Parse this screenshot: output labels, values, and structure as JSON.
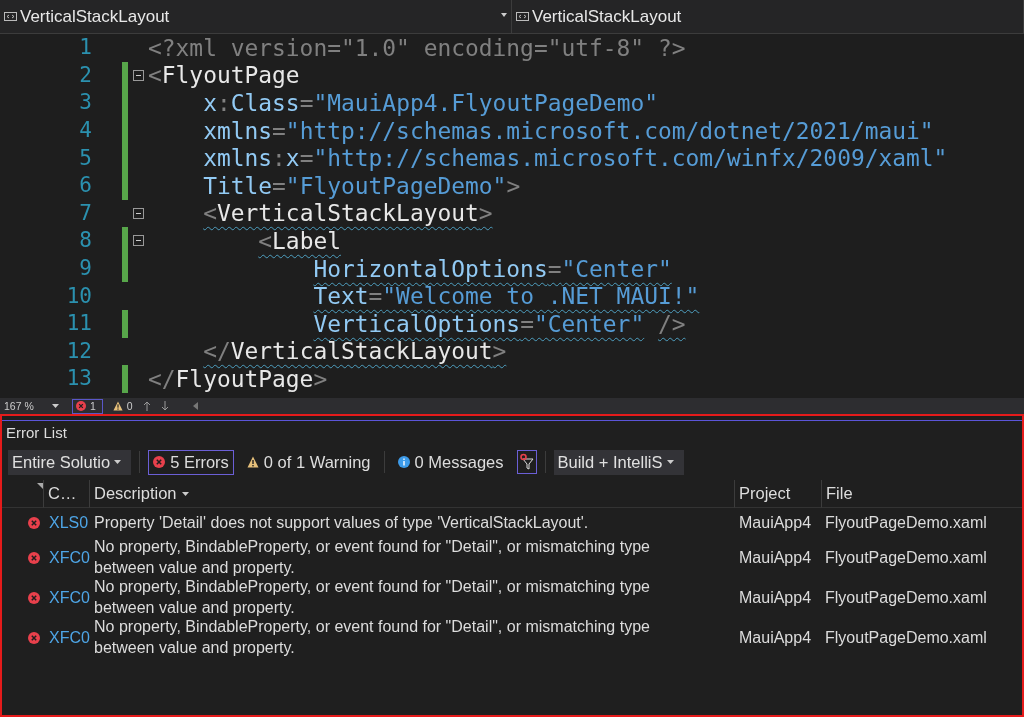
{
  "top_bar": {
    "dropdowns": [
      {
        "label": "VerticalStackLayout"
      },
      {
        "label": "VerticalStackLayout"
      }
    ]
  },
  "editor": {
    "lines": [
      {
        "number": "1",
        "modified": false,
        "fold": false,
        "squiggle": false,
        "tokens": [
          {
            "kind": "decl",
            "text": "<?xml version=\"1.0\" encoding=\"utf-8\" ?>"
          }
        ]
      },
      {
        "number": "2",
        "modified": true,
        "fold": true,
        "squiggle": false,
        "tokens": [
          {
            "kind": "punct",
            "text": "<"
          },
          {
            "kind": "tag",
            "text": "FlyoutPage"
          }
        ]
      },
      {
        "number": "3",
        "modified": true,
        "fold": false,
        "squiggle": false,
        "tokens": [
          {
            "kind": "attr",
            "text": "    x"
          },
          {
            "kind": "punct",
            "text": ":"
          },
          {
            "kind": "attr",
            "text": "Class"
          },
          {
            "kind": "punct",
            "text": "="
          },
          {
            "kind": "value",
            "text": "\"MauiApp4.FlyoutPageDemo\""
          }
        ]
      },
      {
        "number": "4",
        "modified": true,
        "fold": false,
        "squiggle": false,
        "tokens": [
          {
            "kind": "attr",
            "text": "    xmlns"
          },
          {
            "kind": "punct",
            "text": "="
          },
          {
            "kind": "value",
            "text": "\"http://schemas.microsoft.com/dotnet/2021/maui\""
          }
        ]
      },
      {
        "number": "5",
        "modified": true,
        "fold": false,
        "squiggle": false,
        "tokens": [
          {
            "kind": "attr",
            "text": "    xmlns"
          },
          {
            "kind": "punct",
            "text": ":"
          },
          {
            "kind": "attr",
            "text": "x"
          },
          {
            "kind": "punct",
            "text": "="
          },
          {
            "kind": "value",
            "text": "\"http://schemas.microsoft.com/winfx/2009/xaml\""
          }
        ]
      },
      {
        "number": "6",
        "modified": true,
        "fold": false,
        "squiggle": false,
        "tokens": [
          {
            "kind": "attr",
            "text": "    Title"
          },
          {
            "kind": "punct",
            "text": "="
          },
          {
            "kind": "value",
            "text": "\"FlyoutPageDemo\""
          },
          {
            "kind": "punct",
            "text": ">"
          }
        ]
      },
      {
        "number": "7",
        "modified": false,
        "fold": true,
        "squiggle": true,
        "tokens": [
          {
            "kind": "punct",
            "text": "    <"
          },
          {
            "kind": "tag",
            "text": "VerticalStackLayout"
          },
          {
            "kind": "punct",
            "text": ">"
          }
        ]
      },
      {
        "number": "8",
        "modified": true,
        "fold": true,
        "squiggle": true,
        "tokens": [
          {
            "kind": "punct",
            "text": "        <"
          },
          {
            "kind": "tag",
            "text": "Label"
          }
        ]
      },
      {
        "number": "9",
        "modified": true,
        "fold": false,
        "squiggle": true,
        "tokens": [
          {
            "kind": "attr",
            "text": "            HorizontalOptions"
          },
          {
            "kind": "punct",
            "text": "="
          },
          {
            "kind": "value",
            "text": "\"Center\""
          }
        ]
      },
      {
        "number": "10",
        "modified": false,
        "fold": false,
        "squiggle": true,
        "tokens": [
          {
            "kind": "attr",
            "text": "            Text"
          },
          {
            "kind": "punct",
            "text": "="
          },
          {
            "kind": "value",
            "text": "\"Welcome to .NET MAUI!\""
          }
        ]
      },
      {
        "number": "11",
        "modified": true,
        "fold": false,
        "squiggle": true,
        "tokens": [
          {
            "kind": "attr",
            "text": "            VerticalOptions"
          },
          {
            "kind": "punct",
            "text": "="
          },
          {
            "kind": "value",
            "text": "\"Center\""
          },
          {
            "kind": "punct",
            "text": " />"
          }
        ]
      },
      {
        "number": "12",
        "modified": false,
        "fold": false,
        "squiggle": true,
        "tokens": [
          {
            "kind": "punct",
            "text": "    </"
          },
          {
            "kind": "tag",
            "text": "VerticalStackLayout"
          },
          {
            "kind": "punct",
            "text": ">"
          }
        ]
      },
      {
        "number": "13",
        "modified": true,
        "fold": false,
        "squiggle": false,
        "tokens": [
          {
            "kind": "punct",
            "text": "</"
          },
          {
            "kind": "tag",
            "text": "FlyoutPage"
          },
          {
            "kind": "punct",
            "text": ">"
          }
        ]
      }
    ]
  },
  "status_bar": {
    "zoom": "167 %",
    "errors": "1",
    "warnings": "0"
  },
  "error_list": {
    "title": "Error List",
    "toolbar": {
      "scope": "Entire Solutio",
      "errors": {
        "label": "5 Errors",
        "selected": true
      },
      "warnings": {
        "label": "0 of 1 Warning",
        "selected": false
      },
      "messages": {
        "label": "0 Messages",
        "selected": false
      },
      "build_filter": "Build + IntelliS"
    },
    "columns": [
      "C…",
      "Description",
      "Project",
      "File"
    ],
    "rows": [
      {
        "code": "XLS0",
        "description": "Property 'Detail' does not support values of type 'VerticalStackLayout'.",
        "project": "MauiApp4",
        "file": "FlyoutPageDemo.xaml"
      },
      {
        "code": "XFC0",
        "description": "No property, BindableProperty, or event found for \"Detail\", or mismatching type between value and property.",
        "project": "MauiApp4",
        "file": "FlyoutPageDemo.xaml"
      },
      {
        "code": "XFC0",
        "description": "No property, BindableProperty, or event found for \"Detail\", or mismatching type between value and property.",
        "project": "MauiApp4",
        "file": "FlyoutPageDemo.xaml"
      },
      {
        "code": "XFC0",
        "description": "No property, BindableProperty, or event found for \"Detail\", or mismatching type between value and property.",
        "project": "MauiApp4",
        "file": "FlyoutPageDemo.xaml"
      }
    ]
  }
}
